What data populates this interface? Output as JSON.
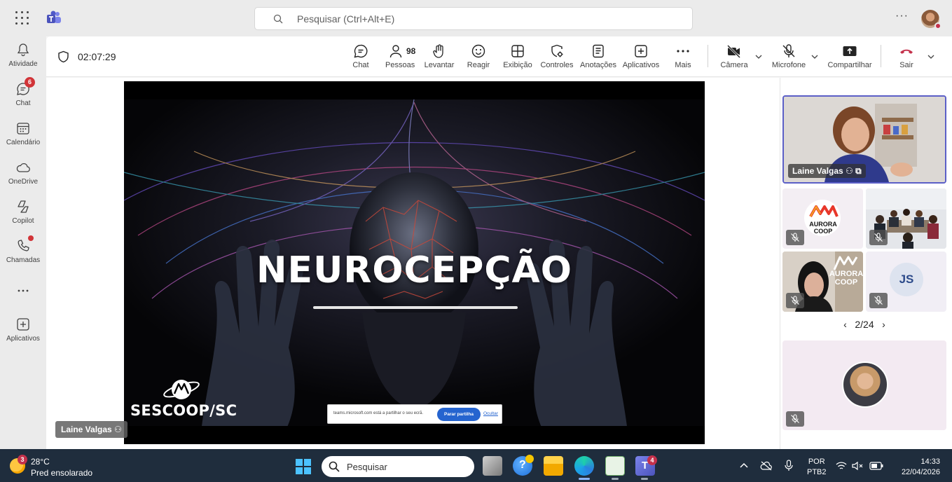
{
  "topbar": {
    "search_placeholder": "Pesquisar (Ctrl+Alt+E)",
    "more_glyph": "···"
  },
  "rail": [
    {
      "label": "Atividade",
      "icon": "bell-icon"
    },
    {
      "label": "Chat",
      "icon": "chat-icon",
      "badge": "6"
    },
    {
      "label": "Calendário",
      "icon": "calendar-icon"
    },
    {
      "label": "OneDrive",
      "icon": "cloud-icon"
    },
    {
      "label": "Copilot",
      "icon": "copilot-icon"
    },
    {
      "label": "Chamadas",
      "icon": "phone-icon",
      "dot": true
    },
    {
      "label": "Aplicativos",
      "icon": "plus-square-icon"
    }
  ],
  "meeting": {
    "timer": "02:07:29",
    "participants_count": "98",
    "tools": {
      "chat": "Chat",
      "people": "Pessoas",
      "raise": "Levantar",
      "react": "Reagir",
      "view": "Exibição",
      "controls": "Controles",
      "notes": "Anotações",
      "apps": "Aplicativos",
      "more": "Mais",
      "camera": "Câmera",
      "mic": "Microfone",
      "share": "Compartilhar",
      "leave": "Sair"
    }
  },
  "slide": {
    "title": "NEUROCEPÇÃO",
    "brand": "SESCOOP/SC",
    "share_notice": "teams.microsoft.com está a partilhar o seu ecrã.",
    "stop_sharing": "Parar partilha",
    "hide": "Ocultar",
    "presenter": "Laine Valgas"
  },
  "panel": {
    "speaker_name": "Laine Valgas",
    "tile_logo_text_1": "AURORA COOP",
    "tile_logo_text_2": "AURORA COOP",
    "initials": "JS",
    "pager": "2/24"
  },
  "taskbar": {
    "weather_badge": "3",
    "temperature": "28°C",
    "condition": "Pred ensolarado",
    "search_label": "Pesquisar",
    "teams_badge": "4",
    "lang_1": "POR",
    "lang_2": "PTB2",
    "time": "14:33",
    "date": "22/04/2026"
  },
  "colors": {
    "accent": "#5b5fc7",
    "leave_red": "#c4314b",
    "taskbar_bg": "#1f2d3d",
    "stop_share_blue": "#2564cf"
  }
}
